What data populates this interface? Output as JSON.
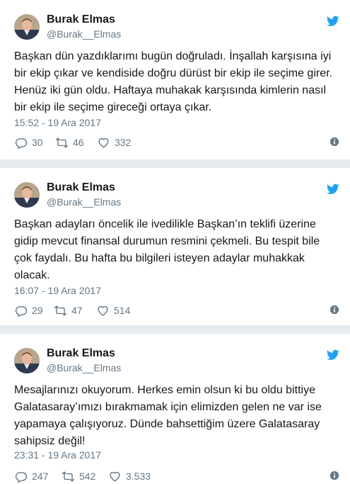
{
  "tweets": [
    {
      "author": {
        "name": "Burak Elmas",
        "handle": "@Burak__Elmas"
      },
      "text": "Başkan dün yazdıklarımı bugün doğruladı. İnşallah karşısına iyi bir ekip çıkar ve kendiside doğru dürüst bir ekip ile seçime girer. Henüz iki gün oldu. Haftaya muhakak karşısında kimlerin nasıl bir ekip ile seçime gireceği ortaya çıkar.",
      "timestamp": "15:52 - 19 Ara 2017",
      "replies": "30",
      "retweets": "46",
      "likes": "332"
    },
    {
      "author": {
        "name": "Burak Elmas",
        "handle": "@Burak__Elmas"
      },
      "text": "Başkan adayları öncelik ile ivedilikle Başkan’ın teklifi üzerine gidip mevcut finansal durumun resmini çekmeli. Bu tespit bile çok faydalı. Bu hafta bu bilgileri isteyen adaylar muhakkak olacak.",
      "timestamp": "16:07 - 19 Ara 2017",
      "replies": "29",
      "retweets": "47",
      "likes": "514"
    },
    {
      "author": {
        "name": "Burak Elmas",
        "handle": "@Burak__Elmas"
      },
      "text": "Mesajlarınızı okuyorum. Herkes emin olsun ki bu oldu bittiye Galatasaray’ımızı bırakmamak için elimizden gelen ne var ise yapamaya çalışıyoruz. Dünde bahsettiğim üzere Galatasaray sahipsiz değil!",
      "timestamp": "23:31 - 19 Ara 2017",
      "replies": "247",
      "retweets": "542",
      "likes": "3.533"
    }
  ],
  "colors": {
    "twitter_blue": "#1da1f2",
    "secondary_text": "#657786",
    "primary_text": "#14171a",
    "background": "#e6ecf0"
  },
  "icons": {
    "brand": "twitter-bird-icon",
    "reply": "reply-icon",
    "retweet": "retweet-icon",
    "like": "heart-icon",
    "info": "info-icon"
  }
}
